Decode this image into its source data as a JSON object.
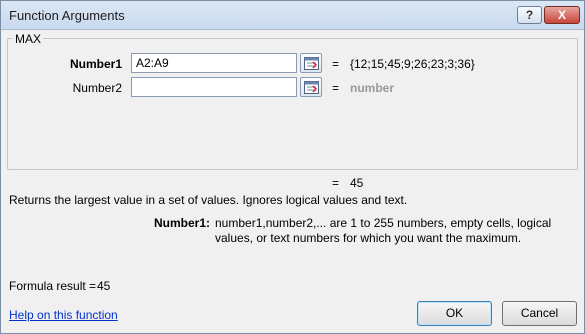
{
  "window": {
    "title": "Function Arguments",
    "help_button": "?",
    "close_button": "X"
  },
  "function": {
    "name": "MAX",
    "arguments": [
      {
        "label": "Number1",
        "value": "A2:A9",
        "evaluated": "{12;15;45;9;26;23;3;36}"
      },
      {
        "label": "Number2",
        "value": "",
        "evaluated": "number"
      }
    ],
    "equals_sign": "=",
    "result": "45",
    "description": "Returns the largest value in a set of values. Ignores logical values and text.",
    "arg_help_label": "Number1:",
    "arg_help_text": "number1,number2,... are 1 to 255 numbers, empty cells, logical values, or text numbers for which you want the maximum."
  },
  "footer": {
    "formula_result_label": "Formula result =",
    "formula_result_value": "45",
    "help_link": "Help on this function",
    "ok_label": "OK",
    "cancel_label": "Cancel"
  },
  "icons": [
    "collapse-dialog-icon"
  ]
}
